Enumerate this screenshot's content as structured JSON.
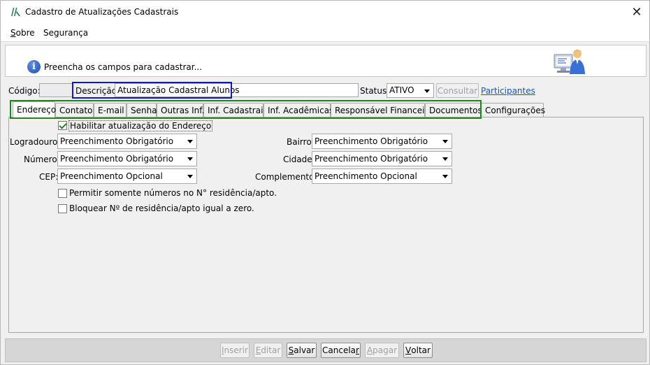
{
  "window": {
    "title": "Cadastro de Atualizações Cadastrais",
    "close_glyph": "✕"
  },
  "menu": {
    "sobre_first": "S",
    "sobre_rest": "obre",
    "seguranca": "Segurança"
  },
  "header": {
    "info_text": "Preencha os campos para cadastrar...",
    "info_glyph": "i"
  },
  "form": {
    "codigo_label": "Código:",
    "codigo_value": "",
    "descricao_label": "Descrição:",
    "descricao_value": "Atualização Cadastral Alunos",
    "status_label": "Status:",
    "status_value": "ATIVO",
    "consultar_label": "Consultar",
    "participantes_link": "Participantes"
  },
  "tabs": [
    {
      "label": "Endereço",
      "active": true
    },
    {
      "label": "Contato",
      "active": false
    },
    {
      "label": "E-mail",
      "active": false
    },
    {
      "label": "Senha",
      "active": false
    },
    {
      "label": "Outras Inf.",
      "active": false
    },
    {
      "label": "Inf. Cadastrais",
      "active": false
    },
    {
      "label": "Inf. Acadêmicas",
      "active": false
    },
    {
      "label": "Responsável Financeiro",
      "active": false
    },
    {
      "label": "Documentos",
      "active": false
    },
    {
      "label": "Configurações",
      "active": false
    }
  ],
  "endereco": {
    "habilitar_label": "Habilitar atualização do Endereço",
    "habilitar_checked": true,
    "logradouro_label": "Logradouro:",
    "logradouro_value": "Preenchimento Obrigatório",
    "numero_label": "Número:",
    "numero_value": "Preenchimento Obrigatório",
    "cep_label": "CEP:",
    "cep_value": "Preenchimento Opcional",
    "bairro_label": "Bairro:",
    "bairro_value": "Preenchimento Obrigatório",
    "cidade_label": "Cidade:",
    "cidade_value": "Preenchimento Obrigatório",
    "complemento_label": "Complemento:",
    "complemento_value": "Preenchimento Opcional",
    "permitir_label": "Permitir somente números no N° residência/apto.",
    "bloquear_label": "Bloquear Nº de residência/apto igual a zero."
  },
  "buttons": {
    "inserir": {
      "u": "I",
      "rest": "nserir"
    },
    "editar": {
      "u": "E",
      "rest": "ditar"
    },
    "salvar": {
      "u": "S",
      "rest": "alvar"
    },
    "cancelar": {
      "pre": "Cancela",
      "u": "r",
      "rest": ""
    },
    "apagar": {
      "u": "A",
      "rest": "pagar"
    },
    "voltar": {
      "u": "V",
      "rest": "oltar"
    }
  },
  "colors": {
    "highlight_blue": "#1414d8",
    "highlight_green": "#1a8a1a",
    "link": "#1a4fd0"
  }
}
